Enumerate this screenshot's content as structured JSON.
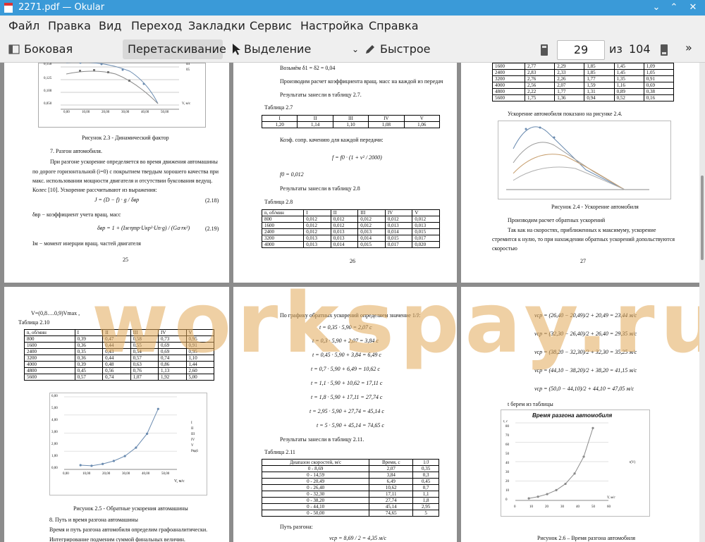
{
  "window": {
    "title": "2271.pdf — Okular"
  },
  "menu": [
    "Файл",
    "Правка",
    "Вид",
    "Переход",
    "Закладки",
    "Сервис",
    "Настройка",
    "Справка"
  ],
  "toolbar": {
    "sidebar": "Боковая панель",
    "drag": "Перетаскивание",
    "select_text": "Выделение текста",
    "quick_comment": "Быстрое комментирование",
    "page_value": "29",
    "of_label": "из",
    "total_pages": "104"
  },
  "watermark": "workspay.ru",
  "pages": {
    "p25": {
      "legend1": "III",
      "legend2": "IV",
      "legend3": "IV",
      "legend4": "05",
      "y_ticks": [
        "0,150",
        "0,125",
        "0,100",
        "0,050"
      ],
      "x_ticks": [
        "0,00",
        "10,00",
        "20,00",
        "30,00",
        "40,00",
        "50,00",
        "60,00"
      ],
      "xunit": "V, м/с",
      "caption": "Рисунок 2.3 - Динамический фактор",
      "h": "7. Разгон автомобиля.",
      "p1": "При разгоне ускорение определяется во время движения автомашины",
      "p2": "по дороге горизонтальной (i=0) с покрытием твердым хорошего качества при",
      "p3": "макс. использовании мощности двигателя и отсутствии буксования ведущ.",
      "p4": "Колес [10]. Ускорение рассчитывают из выражения:",
      "f1": "J = (D − f) · g / δвр",
      "f1n": "(2.18)",
      "p5": "δвр − коэффициент учета вращ. масс",
      "f2": "δвр = 1 + (Iм·ηтр·Uкр²·Uп·g) / (Gа·rк²)",
      "f2n": "(2.19)",
      "p6": "Iм − момент инерции вращ. частей двигателя",
      "num": "25"
    },
    "p26": {
      "l1": "Возьмём δ1 = δ2 = 0,04",
      "l2": "Производим расчет коэффициента вращ. масс на каждой из передач",
      "l3": "Результаты занесли в таблицу 2.7.",
      "t27": "Таблица 2.7",
      "t27h": [
        "I",
        "II",
        "III",
        "IV",
        "V"
      ],
      "t27v": [
        "1,20",
        "1,14",
        "1,10",
        "1,08",
        "1,06"
      ],
      "l4": "Коэф. сопр. качению для каждой передачи:",
      "f": "f = f0 · (1 + v² / 2000)",
      "f0": "f0 = 0,012",
      "l5": "Результаты занесли в таблицу 2.8",
      "t28": "Таблица 2.8",
      "t28h": [
        "n, об/мин",
        "I",
        "II",
        "III",
        "IV",
        "V"
      ],
      "t28r": [
        [
          "800",
          "0,012",
          "0,012",
          "0,012",
          "0,012",
          "0,012"
        ],
        [
          "1600",
          "0,012",
          "0,012",
          "0,012",
          "0,013",
          "0,013"
        ],
        [
          "2400",
          "0,012",
          "0,013",
          "0,013",
          "0,014",
          "0,015"
        ],
        [
          "3200",
          "0,013",
          "0,013",
          "0,014",
          "0,015",
          "0,017"
        ],
        [
          "4000",
          "0,013",
          "0,014",
          "0,015",
          "0,017",
          "0,020"
        ]
      ],
      "num": "26"
    },
    "p27": {
      "t_rows": [
        [
          "1600",
          "2,77",
          "2,29",
          "1,85",
          "1,45",
          "1,09"
        ],
        [
          "2400",
          "2,83",
          "2,33",
          "1,85",
          "1,45",
          "1,05"
        ],
        [
          "3200",
          "2,76",
          "2,26",
          "1,77",
          "1,35",
          "0,91"
        ],
        [
          "4000",
          "2,56",
          "2,07",
          "1,59",
          "1,16",
          "0,69"
        ],
        [
          "4800",
          "2,22",
          "1,77",
          "1,31",
          "0,89",
          "0,38"
        ],
        [
          "5600",
          "1,75",
          "1,36",
          "0,94",
          "0,52",
          "0,16"
        ]
      ],
      "l1": "Ускорение автомобиля показано на рисунке 2.4.",
      "caption": "Рисунок 2.4 - Ускорение автомобиля",
      "l2": "Производим расчет обратных ускорений",
      "l3": "Так как на скоростях, приближенных к максимуму, ускорение",
      "l4": "стремится к нулю, то при нахождении обратных ускорений допольствуются",
      "l5": "скоростью",
      "num": "27"
    },
    "p28": {
      "l1": "V=(0,8….0,9)Vmax ,",
      "t210": "Таблица 2.10",
      "th": [
        "n, об/мин",
        "I",
        "II",
        "III",
        "IV",
        "V"
      ],
      "tr": [
        [
          "800",
          "0,39",
          "0,47",
          "0,58",
          "0,73",
          "0,95"
        ],
        [
          "1600",
          "0,36",
          "0,44",
          "0,55",
          "0,69",
          "0,91"
        ],
        [
          "2400",
          "0,35",
          "0,43",
          "0,54",
          "0,69",
          "0,95"
        ],
        [
          "3200",
          "0,36",
          "0,44",
          "0,57",
          "0,74",
          "1,10"
        ],
        [
          "4000",
          "0,39",
          "0,48",
          "0,63",
          "0,86",
          "1,44"
        ],
        [
          "4800",
          "0,45",
          "0,56",
          "0,76",
          "1,13",
          "2,60"
        ],
        [
          "5600",
          "0,57",
          "0,74",
          "1,07",
          "1,92",
          "5,00"
        ]
      ],
      "y_ticks": [
        "6,00",
        "5,00",
        "4,00",
        "3,00",
        "2,00",
        "1,00",
        "0,00"
      ],
      "x_ticks": [
        "0,00",
        "10,00",
        "20,00",
        "30,00",
        "40,00",
        "50,00",
        "60,00"
      ],
      "legend": [
        "I",
        "II",
        "III",
        "IV",
        "V",
        "Ряд6"
      ],
      "xunit": "V, м/с",
      "caption": "Рисунок 2.5 - Обратные ускорения автомашины",
      "l2": "8. Путь и время разгона автомашины",
      "l3": "Время и путь разгона автомобиля определим графоаналитически.",
      "l4": "Интегрирование подменим суммой финальных величин."
    },
    "p29": {
      "l1": "По графику обратных ускорений определяем значение 1/J:",
      "eqs": [
        "t = 0,35 · 5,90 = 2,07 с",
        "t = 0,3 · 5,90 + 2,07 = 3,84 с",
        "t = 0,45 · 5,90 + 3,84 = 6,49 с",
        "t = 0,7 · 5,90 + 6,49 = 10,62 с",
        "t = 1,1 · 5,90 + 10,62 = 17,11 с",
        "t = 1,8 · 5,90 + 17,11 = 27,74 с",
        "t = 2,95 · 5,90 + 27,74 = 45,14 с",
        "t = 5 · 5,90 + 45,14 = 74,65 с"
      ],
      "l2": "Результаты занесли в таблицу 2.11.",
      "t211": "Таблица 2.11",
      "th": [
        "Диапазон скоростей, м/с",
        "Время, с",
        "1/J"
      ],
      "tr": [
        [
          "0 - 8,69",
          "2,07",
          "0,35"
        ],
        [
          "0 - 14,59",
          "3,84",
          "0,3"
        ],
        [
          "0 - 20,49",
          "6,49",
          "0,45"
        ],
        [
          "0 - 26,40",
          "10,62",
          "0,7"
        ],
        [
          "0 - 32,30",
          "17,11",
          "1,1"
        ],
        [
          "0 - 38,20",
          "27,74",
          "1,8"
        ],
        [
          "0 - 44,10",
          "45,14",
          "2,95"
        ],
        [
          "0 - 50,00",
          "74,65",
          "5"
        ]
      ],
      "l3": "Путь разгона:",
      "f": "vср = 8,69 / 2 = 4,35 м/с"
    },
    "p30": {
      "eqs": [
        "vср = (26,40 − 20,49)/2 + 20,49 = 23,44 м/с",
        "vср = (32,30 − 26,40)/2 + 26,40 = 29,35 м/с",
        "vср = (38,20 − 32,30)/2 + 32,30 = 35,25 м/с",
        "vср = (44,10 − 38,20)/2 + 38,20 = 41,15 м/с",
        "vср = (50,0 − 44,10)/2 + 44,10 = 47,05 м/с"
      ],
      "l1": "t берем из таблицы",
      "chart_title": "Время разгона автомобиля",
      "yunit": "t, с",
      "xunit": "V, м/с",
      "legend": "t(V)",
      "y_ticks": [
        "80",
        "70",
        "60",
        "50",
        "40",
        "30",
        "20",
        "10",
        "0"
      ],
      "x_ticks": [
        "0",
        "10",
        "20",
        "30",
        "40",
        "50",
        "60"
      ],
      "caption": "Рисунок 2.6 – Время разгона автомобиля"
    }
  },
  "chart_data": [
    {
      "type": "line",
      "title": "Время разгона автомобиля",
      "xlabel": "V, м/с",
      "ylabel": "t, с",
      "x": [
        8.69,
        14.59,
        20.49,
        26.4,
        32.3,
        38.2,
        44.1,
        50.0
      ],
      "series": [
        {
          "name": "t(V)",
          "values": [
            2.07,
            3.84,
            6.49,
            10.62,
            17.11,
            27.74,
            45.14,
            74.65
          ]
        }
      ],
      "xlim": [
        0,
        60
      ],
      "ylim": [
        0,
        80
      ]
    },
    {
      "type": "line",
      "title": "",
      "xlabel": "V, м/с",
      "ylabel": "",
      "x": [
        8.69,
        14.59,
        20.49,
        26.4,
        32.3,
        38.2,
        44.1,
        50.0
      ],
      "series": [
        {
          "name": "Ряд6",
          "values": [
            0.35,
            0.3,
            0.45,
            0.7,
            1.1,
            1.8,
            2.95,
            5
          ]
        }
      ],
      "xlim": [
        0,
        60
      ],
      "ylim": [
        0,
        6
      ]
    }
  ]
}
